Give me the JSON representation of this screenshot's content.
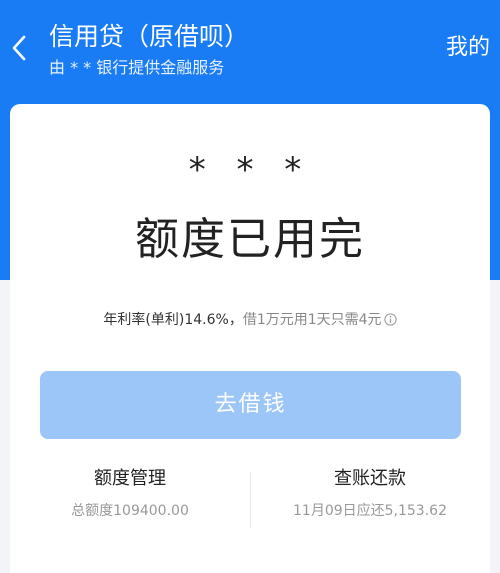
{
  "header": {
    "title": "信用贷（原借呗）",
    "subtitle": "由 * * 银行提供金融服务",
    "right_link": "我的",
    "back_icon": "chevron-left-icon"
  },
  "card": {
    "masked_name": "* * *",
    "status": "额度已用完",
    "rate_main": "年利率(单利)14.6%，",
    "rate_extra": "借1万元用1天只需4元",
    "borrow_button": "去借钱",
    "quota": {
      "title": "额度管理",
      "detail": "总额度109400.00"
    },
    "repay": {
      "title": "查账还款",
      "detail": "11月09日应还5,153.62"
    }
  },
  "colors": {
    "brand_blue": "#1a7cf4",
    "button_disabled": "#9cc6f7"
  }
}
